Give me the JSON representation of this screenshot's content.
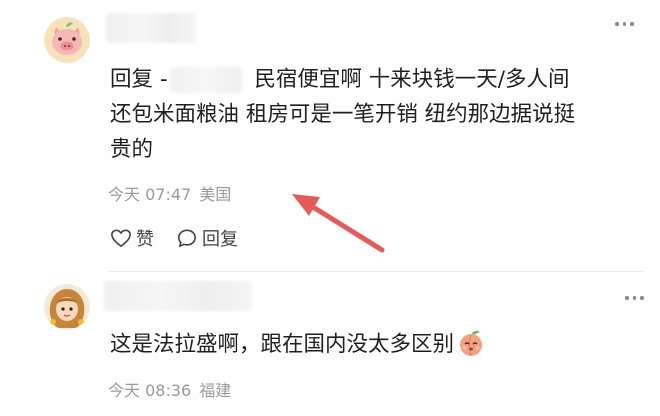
{
  "comments": [
    {
      "reply_prefix": "回复 -",
      "text_line1_rest": " 民宿便宜啊 十来块钱一天/多人间",
      "text_line2": "还包米面粮油 租房可是一笔开销 纽约那边据说挺",
      "text_line3": "贵的",
      "time": "今天 07:47",
      "location": "美国",
      "like_label": "赞",
      "reply_label": "回复",
      "avatar_icon": "pig-face-avatar"
    },
    {
      "text": "这是法拉盛啊，跟在国内没太多区别",
      "emoji": "peach-face-emoji",
      "time": "今天 08:36",
      "location": "福建",
      "avatar_icon": "cartoon-girl-avatar"
    }
  ],
  "colors": {
    "text": "#1f1f1f",
    "meta": "#9a9a9a",
    "arrow": "#e65a5a"
  }
}
